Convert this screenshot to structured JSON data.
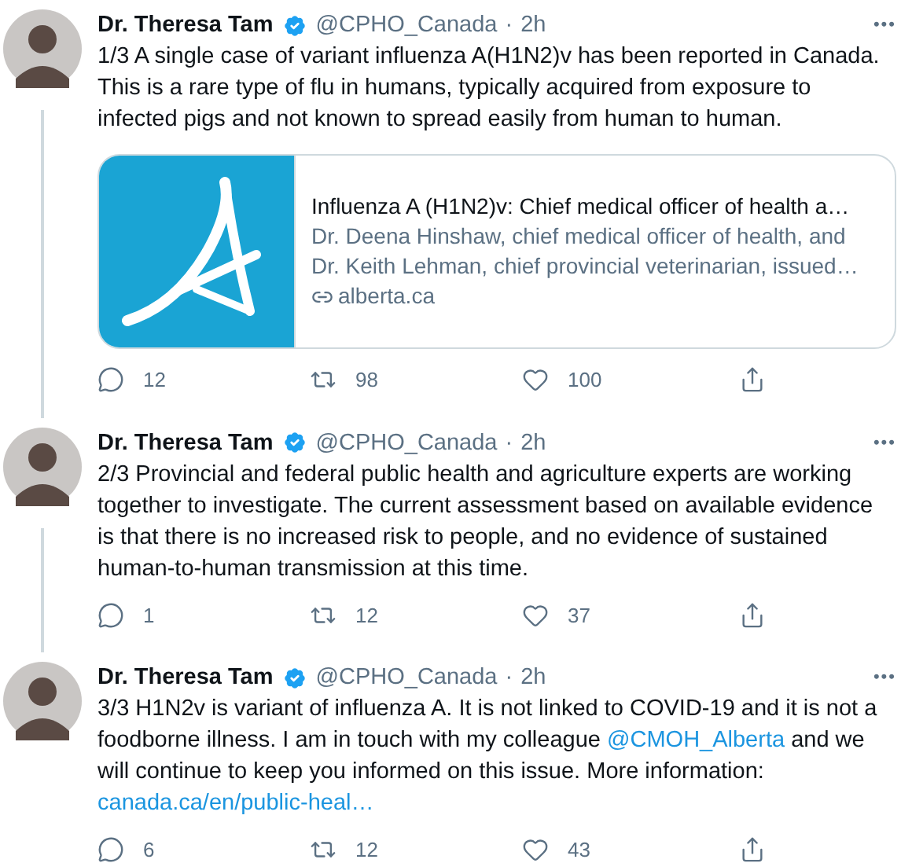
{
  "tweets": [
    {
      "name": "Dr. Theresa Tam",
      "verified": true,
      "handle": "@CPHO_Canada",
      "separator": "·",
      "time": "2h",
      "more": "•••",
      "thread_below": true,
      "parts": [
        {
          "kind": "text",
          "text": "1/3 A single case of variant influenza A(H1N2)v has been reported in Canada. This is a rare type of flu in humans, typically acquired from exposure to infected pigs and not known to spread easily from human to human."
        }
      ],
      "card": {
        "title": "Influenza A (H1N2)v: Chief medical officer of health a…",
        "description": "Dr. Deena Hinshaw, chief medical officer of health, and Dr. Keith Lehman, chief provincial veterinarian, issued…",
        "domain": "alberta.ca"
      },
      "replies": "12",
      "retweets": "98",
      "likes": "100"
    },
    {
      "name": "Dr. Theresa Tam",
      "verified": true,
      "handle": "@CPHO_Canada",
      "separator": "·",
      "time": "2h",
      "more": "•••",
      "thread_below": true,
      "parts": [
        {
          "kind": "text",
          "text": "2/3 Provincial and federal public health and agriculture experts are working together to investigate. The current assessment based on available evidence is that there is no increased risk to people, and no evidence of sustained human-to-human transmission at this time."
        }
      ],
      "replies": "1",
      "retweets": "12",
      "likes": "37"
    },
    {
      "name": "Dr. Theresa Tam",
      "verified": true,
      "handle": "@CPHO_Canada",
      "separator": "·",
      "time": "2h",
      "more": "•••",
      "thread_below": false,
      "parts": [
        {
          "kind": "text",
          "text": "3/3 H1N2v is variant of influenza A. It is not linked to COVID-19 and it is not a foodborne illness. I am in touch with my colleague "
        },
        {
          "kind": "mention",
          "text": "@CMOH_Alberta"
        },
        {
          "kind": "text",
          "text": " and we will continue to keep you informed on this issue. More information: "
        },
        {
          "kind": "link",
          "text": "canada.ca/en/public-heal…"
        }
      ],
      "replies": "6",
      "retweets": "12",
      "likes": "43"
    }
  ]
}
